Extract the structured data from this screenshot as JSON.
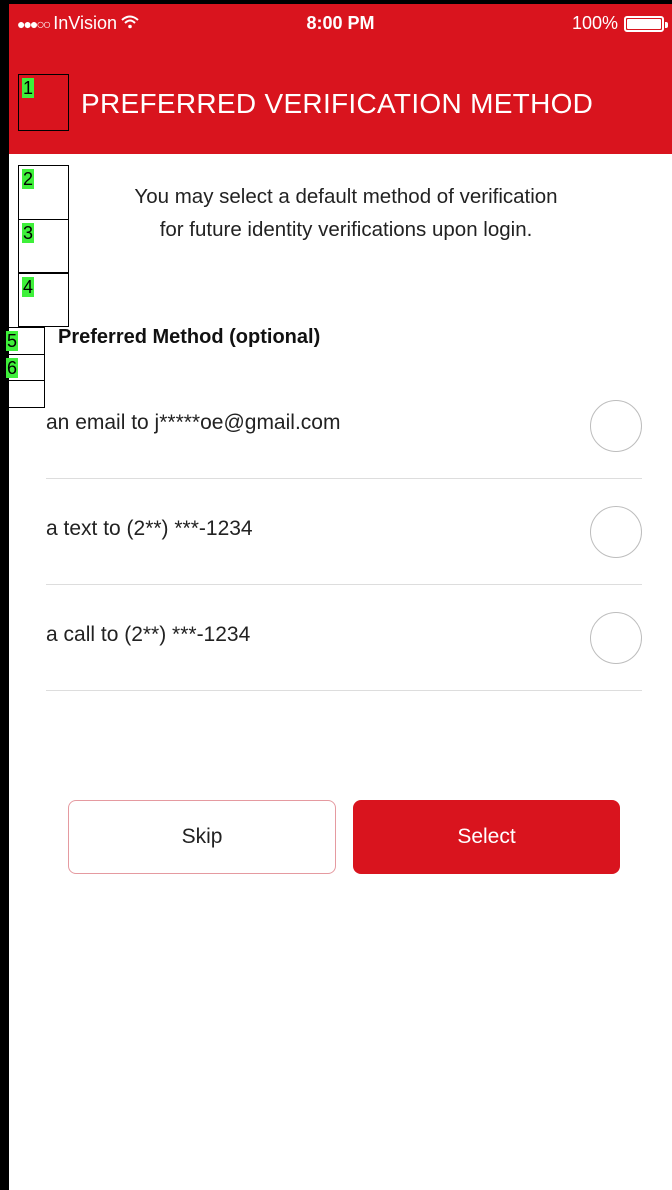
{
  "status_bar": {
    "carrier": "InVision",
    "time": "8:00 PM",
    "battery_percent": "100%",
    "signal_dots": "●●●○○",
    "wifi_icon": "wifi-icon",
    "battery_level": 1.0
  },
  "header": {
    "title": "PREFERRED VERIFICATION METHOD",
    "background_color": "#d9141e"
  },
  "intro": {
    "line1": "You may select a default method of verification",
    "line2": "for future identity verifications upon login."
  },
  "section": {
    "heading": "Preferred Method (optional)"
  },
  "options": [
    {
      "label": "an email to j*****oe@gmail.com",
      "selected": false
    },
    {
      "label": "a text to (2**) ***-1234",
      "selected": false
    },
    {
      "label": "a call to (2**) ***-1234",
      "selected": false
    }
  ],
  "buttons": {
    "skip_label": "Skip",
    "select_label": "Select"
  },
  "markers": [
    "1",
    "2",
    "3",
    "4",
    "5",
    "6"
  ],
  "colors": {
    "accent": "#d9141e",
    "marker_label_bg": "#3ef03a"
  }
}
